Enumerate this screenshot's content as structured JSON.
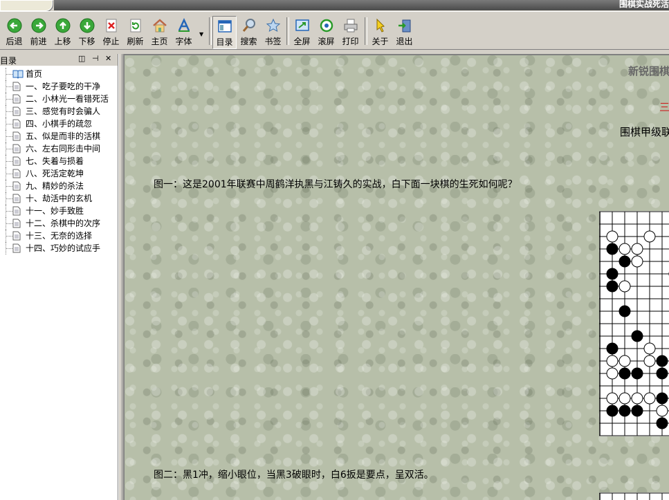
{
  "window": {
    "title": "围棋实战死活"
  },
  "toolbar": {
    "buttons": [
      {
        "label": "后退",
        "icon": "back-arrow-icon"
      },
      {
        "label": "前进",
        "icon": "forward-arrow-icon"
      },
      {
        "label": "上移",
        "icon": "up-arrow-icon"
      },
      {
        "label": "下移",
        "icon": "down-arrow-icon"
      },
      {
        "label": "停止",
        "icon": "stop-icon"
      },
      {
        "label": "刷新",
        "icon": "refresh-icon"
      },
      {
        "label": "主页",
        "icon": "home-icon"
      },
      {
        "label": "字体",
        "icon": "font-icon"
      },
      {
        "label": "目录",
        "icon": "contents-icon"
      },
      {
        "label": "搜索",
        "icon": "search-icon"
      },
      {
        "label": "书签",
        "icon": "bookmark-star-icon"
      },
      {
        "label": "全屏",
        "icon": "fullscreen-icon"
      },
      {
        "label": "滚屏",
        "icon": "autoscroll-icon"
      },
      {
        "label": "打印",
        "icon": "print-icon"
      },
      {
        "label": "关于",
        "icon": "about-icon"
      },
      {
        "label": "退出",
        "icon": "exit-icon"
      }
    ]
  },
  "sidebar": {
    "title": "目录",
    "controls": [
      "◫",
      "⊣",
      "✕"
    ],
    "items": [
      {
        "label": "首页",
        "icon": "book-icon"
      },
      {
        "label": "一、吃子要吃的干净",
        "icon": "page-icon"
      },
      {
        "label": "二、小林光一看错死活",
        "icon": "page-icon"
      },
      {
        "label": "三、感觉有时会骗人",
        "icon": "page-icon"
      },
      {
        "label": "四、小棋手的疏忽",
        "icon": "page-icon"
      },
      {
        "label": "五、似是而非的活棋",
        "icon": "page-icon"
      },
      {
        "label": "六、左右同形击中间",
        "icon": "page-icon"
      },
      {
        "label": "七、失着与损着",
        "icon": "page-icon"
      },
      {
        "label": "八、死活定乾坤",
        "icon": "page-icon"
      },
      {
        "label": "九、精妙的杀法",
        "icon": "page-icon"
      },
      {
        "label": "十、劫活中的玄机",
        "icon": "page-icon"
      },
      {
        "label": "十一、妙手致胜",
        "icon": "page-icon"
      },
      {
        "label": "十二、杀棋中的次序",
        "icon": "page-icon"
      },
      {
        "label": "十三、无奈的选择",
        "icon": "page-icon"
      },
      {
        "label": "十四、巧妙的试应手",
        "icon": "page-icon"
      }
    ]
  },
  "content": {
    "title_partial": "新锐围棋",
    "red_partial": "三",
    "subtitle_partial": "围棋甲级联",
    "figure1_text": "图一：这是2001年联赛中周鹤洋执黑与江铸久的实战，白下面一块棋的生死如何呢？",
    "figure2_text": "图二：黑1冲，缩小眼位，当黑3破眼时，白6扳是要点，呈双活。"
  },
  "colors": {
    "content_bg": "#b7bfa9",
    "red_heading": "#cc2222",
    "title_gray": "#666666"
  }
}
